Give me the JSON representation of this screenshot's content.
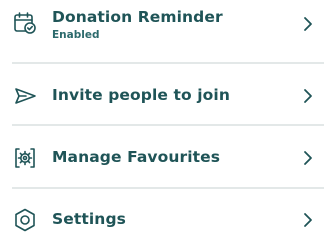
{
  "menu": {
    "items": [
      {
        "label": "Donation Reminder",
        "sublabel": "Enabled",
        "icon": "calendar-check-icon"
      },
      {
        "label": "Invite people to join",
        "icon": "paper-plane-icon"
      },
      {
        "label": "Manage Favourites",
        "icon": "favourites-gear-icon"
      },
      {
        "label": "Settings",
        "icon": "hexagon-settings-icon"
      }
    ],
    "chevron_icon": "chevron-right-icon"
  },
  "colors": {
    "text": "#1f5457",
    "icon": "#1f5457",
    "divider": "#e3e8e8",
    "background": "#ffffff"
  }
}
